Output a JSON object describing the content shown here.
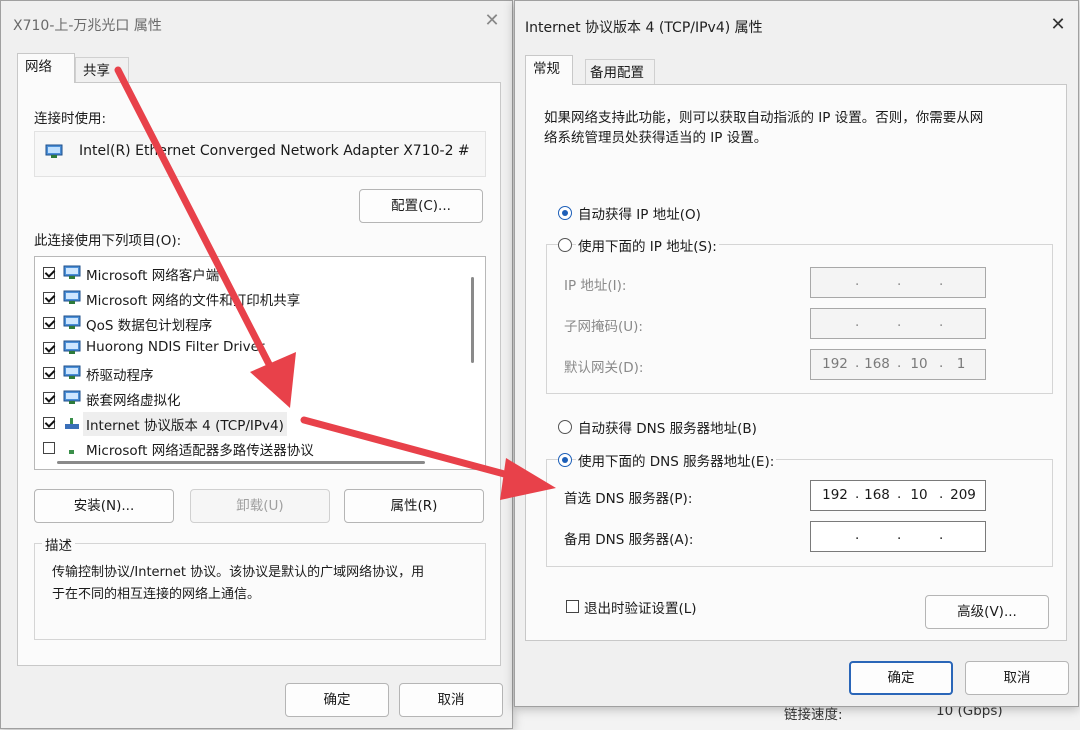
{
  "left_dialog": {
    "title": "X710-上-万兆光口 属性",
    "tabs": [
      "网络",
      "共享"
    ],
    "connect_using_label": "连接时使用:",
    "adapter_name": "Intel(R) Ethernet Converged Network Adapter X710-2 #",
    "configure_button": "配置(C)...",
    "items_label": "此连接使用下列项目(O):",
    "items": [
      {
        "label": "Microsoft 网络客户端",
        "checked": true,
        "icon": "network-client-icon"
      },
      {
        "label": "Microsoft 网络的文件和打印机共享",
        "checked": true,
        "icon": "file-sharing-icon"
      },
      {
        "label": "QoS 数据包计划程序",
        "checked": true,
        "icon": "qos-icon"
      },
      {
        "label": "Huorong NDIS Filter Driver",
        "checked": true,
        "icon": "filter-driver-icon"
      },
      {
        "label": "桥驱动程序",
        "checked": true,
        "icon": "bridge-icon"
      },
      {
        "label": "嵌套网络虚拟化",
        "checked": true,
        "icon": "virtualization-icon"
      },
      {
        "label": "Internet 协议版本 4 (TCP/IPv4)",
        "checked": true,
        "icon": "protocol-icon"
      },
      {
        "label": "Microsoft 网络适配器多路传送器协议",
        "checked": false,
        "icon": "protocol-icon"
      }
    ],
    "install_button": "安装(N)...",
    "uninstall_button": "卸载(U)",
    "properties_button": "属性(R)",
    "description_label": "描述",
    "description_text_line1": "传输控制协议/Internet 协议。该协议是默认的广域网络协议，用",
    "description_text_line2": "于在不同的相互连接的网络上通信。",
    "ok_button": "确定",
    "cancel_button": "取消"
  },
  "right_dialog": {
    "title": "Internet 协议版本 4 (TCP/IPv4) 属性",
    "tabs": [
      "常规",
      "备用配置"
    ],
    "intro_line1": "如果网络支持此功能，则可以获取自动指派的 IP 设置。否则，你需要从网",
    "intro_line2": "络系统管理员处获得适当的 IP 设置。",
    "auto_ip_label": "自动获得 IP 地址(O)",
    "manual_ip_label": "使用下面的 IP 地址(S):",
    "ip_label": "IP 地址(I):",
    "mask_label": "子网掩码(U):",
    "gateway_label": "默认网关(D):",
    "gateway_octets": [
      "192",
      "168",
      "10",
      "1"
    ],
    "auto_dns_label": "自动获得 DNS 服务器地址(B)",
    "manual_dns_label": "使用下面的 DNS 服务器地址(E):",
    "preferred_dns_label": "首选 DNS 服务器(P):",
    "preferred_dns_octets": [
      "192",
      "168",
      "10",
      "209"
    ],
    "alternate_dns_label": "备用 DNS 服务器(A):",
    "validate_label": "退出时验证设置(L)",
    "advanced_button": "高级(V)...",
    "ok_button": "确定",
    "cancel_button": "取消",
    "auto_ip_selected": true,
    "manual_dns_selected": true,
    "validate_checked": false
  },
  "background": {
    "link_speed_label": "链接速度:",
    "link_speed_value": "10 (Gbps)"
  },
  "colors": {
    "arrow": "#e8414a",
    "accent": "#1d5fb8"
  }
}
